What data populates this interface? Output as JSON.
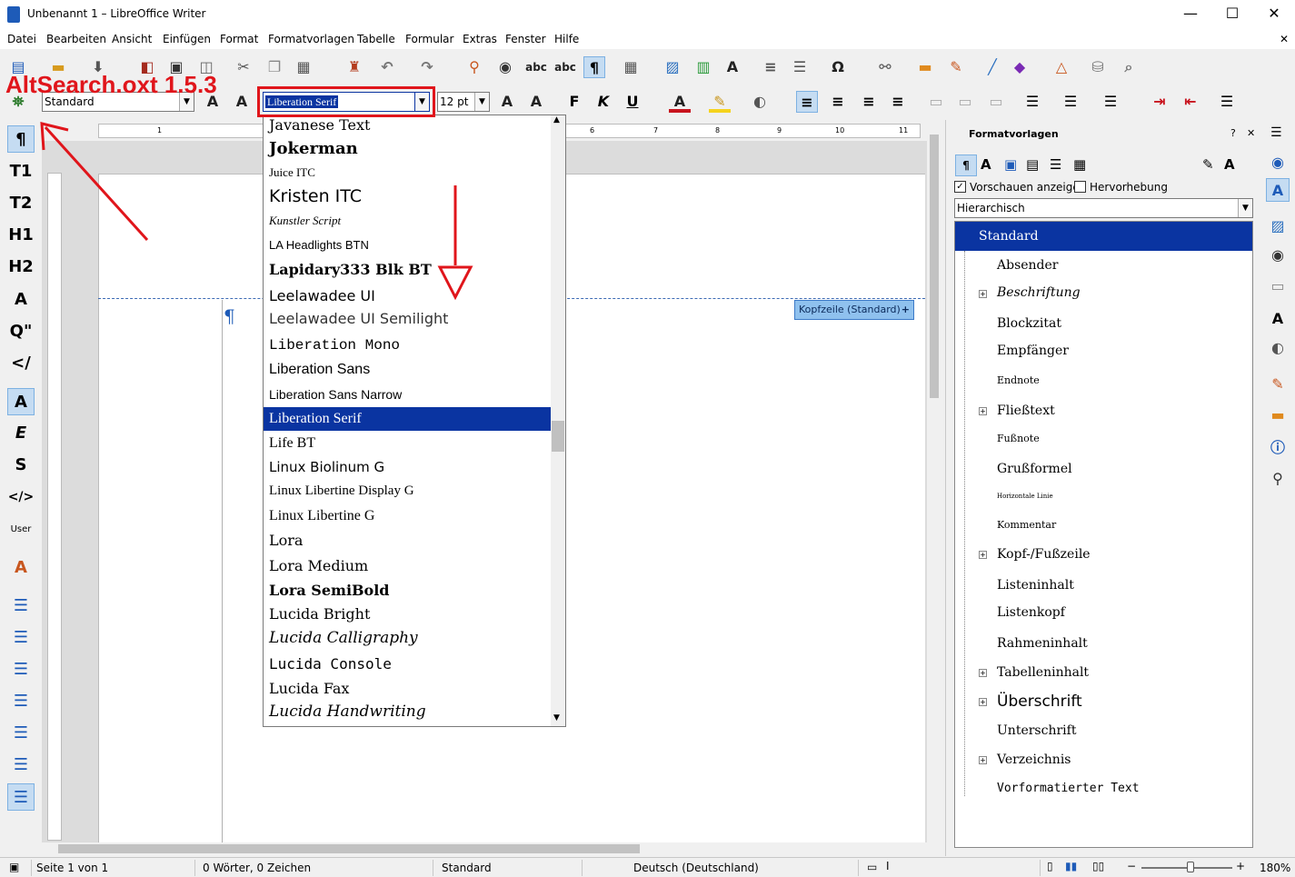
{
  "window": {
    "title": "Unbenannt 1 – LibreOffice Writer",
    "minimize": "—",
    "maximize": "☐",
    "close": "✕"
  },
  "menu": [
    "Datei",
    "Bearbeiten",
    "Ansicht",
    "Einfügen",
    "Format",
    "Formatvorlagen",
    "Tabelle",
    "Formular",
    "Extras",
    "Fenster",
    "Hilfe"
  ],
  "menu_close": "✕",
  "formatting": {
    "paragraph_style": "Standard",
    "font_name": "Liberation Serif",
    "font_size": "12 pt"
  },
  "annotation": {
    "overlay_text": "AltSearch.oxt 1.5.3",
    "accent_color": "#e0151b"
  },
  "font_list": {
    "items": [
      "Javanese Text",
      "Jokerman",
      "Juice ITC",
      "Kristen ITC",
      "Kunstler Script",
      "LA Headlights BTN",
      "Lapidary333 Blk BT",
      "Leelawadee UI",
      "Leelawadee UI Semilight",
      "Liberation Mono",
      "Liberation Sans",
      "Liberation Sans Narrow",
      "Liberation Serif",
      "Life BT",
      "Linux Biolinum G",
      "Linux Libertine Display G",
      "Linux Libertine G",
      "Lora",
      "Lora Medium",
      "Lora SemiBold",
      "Lucida Bright",
      "Lucida Calligraphy",
      "Lucida Console",
      "Lucida Fax",
      "Lucida Handwriting"
    ],
    "selected": "Liberation Serif"
  },
  "header_tag": "Kopfzeile (Standard)",
  "ruler_numbers": [
    "1",
    "6",
    "7",
    "8",
    "9",
    "10",
    "11"
  ],
  "sidebar": {
    "title": "Formatvorlagen",
    "help": "?",
    "close": "✕",
    "show_previews": "Vorschauen anzeigen",
    "highlight": "Hervorhebung",
    "filter": "Hierarchisch",
    "styles": [
      "Standard",
      "Absender",
      "Beschriftung",
      "Blockzitat",
      "Empfänger",
      "Endnote",
      "Fließtext",
      "Fußnote",
      "Grußformel",
      "Horizontale Linie",
      "Kommentar",
      "Kopf-/Fußzeile",
      "Listeninhalt",
      "Listenkopf",
      "Rahmeninhalt",
      "Tabelleninhalt",
      "Überschrift",
      "Unterschrift",
      "Verzeichnis",
      "Vorformatierter Text"
    ]
  },
  "left_styles": [
    "¶",
    "T1",
    "T2",
    "H1",
    "H2",
    "A",
    "Q\"",
    "</",
    "A",
    "E",
    "S",
    "</>",
    "User",
    "A"
  ],
  "status": {
    "page": "Seite 1 von 1",
    "words": "0 Wörter, 0 Zeichen",
    "style": "Standard",
    "language": "Deutsch (Deutschland)",
    "zoom": "180%"
  }
}
